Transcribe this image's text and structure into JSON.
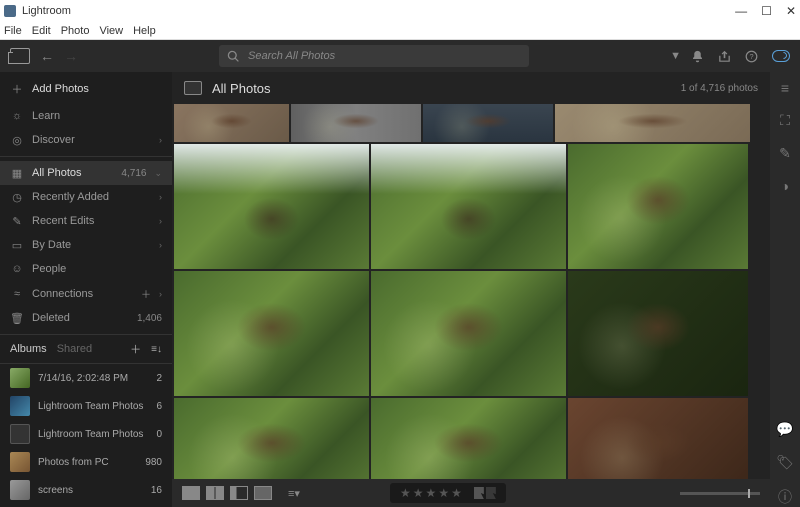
{
  "window": {
    "title": "Lightroom"
  },
  "menubar": [
    "File",
    "Edit",
    "Photo",
    "View",
    "Help"
  ],
  "search": {
    "placeholder": "Search All Photos"
  },
  "sidebar": {
    "addPhotos": "Add Photos",
    "learn": "Learn",
    "discover": "Discover",
    "items": [
      {
        "icon": "grid",
        "label": "All Photos",
        "count": "4,716",
        "active": true,
        "chev": "⌄"
      },
      {
        "icon": "clock",
        "label": "Recently Added",
        "chev": "›"
      },
      {
        "icon": "pencil",
        "label": "Recent Edits",
        "chev": "›"
      },
      {
        "icon": "calendar",
        "label": "By Date",
        "chev": "›"
      },
      {
        "icon": "person",
        "label": "People"
      },
      {
        "icon": "link",
        "label": "Connections",
        "plus": true,
        "chev": "›"
      },
      {
        "icon": "trash",
        "label": "Deleted",
        "count": "1,406"
      }
    ]
  },
  "albumsHeader": {
    "albums": "Albums",
    "shared": "Shared"
  },
  "albums": [
    {
      "label": "7/14/16, 2:02:48 PM",
      "count": "2"
    },
    {
      "label": "Lightroom Team Photos",
      "count": "6"
    },
    {
      "label": "Lightroom Team Photos",
      "count": "0"
    },
    {
      "label": "Photos from PC",
      "count": "980"
    },
    {
      "label": "screens",
      "count": "16"
    }
  ],
  "content": {
    "title": "All Photos",
    "info": "1 of 4,716 photos"
  },
  "winControls": {
    "min": "—",
    "max": "☐",
    "close": "✕"
  }
}
